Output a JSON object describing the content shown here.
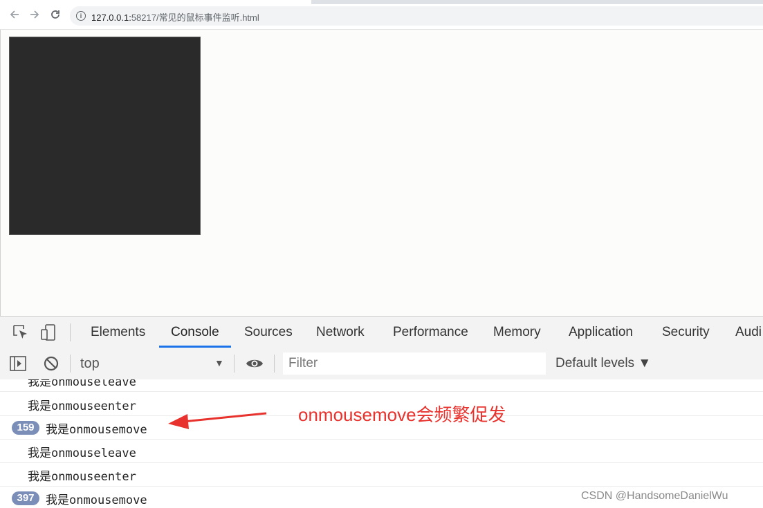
{
  "browser": {
    "url_host": "127.0.0.1:",
    "url_path": "58217/常见的鼠标事件监听.html",
    "back_icon": "back-arrow-icon",
    "forward_icon": "forward-arrow-icon",
    "reload_icon": "reload-icon",
    "site_info_icon": "info-icon"
  },
  "page": {
    "box_color": "#2a2a2a"
  },
  "devtools": {
    "tabs": [
      "Elements",
      "Console",
      "Sources",
      "Network",
      "Performance",
      "Memory",
      "Application",
      "Security",
      "Audi"
    ],
    "active_tab": "Console",
    "context": "top",
    "filter_placeholder": "Filter",
    "levels": "Default levels ▼",
    "accent_color": "#1a73e8"
  },
  "console": {
    "rows": [
      {
        "prefix": "我是",
        "event": "onmouseleave",
        "count": ""
      },
      {
        "prefix": "我是",
        "event": "onmouseenter",
        "count": ""
      },
      {
        "prefix": "我是",
        "event": "onmousemove",
        "count": "159"
      },
      {
        "prefix": "我是",
        "event": "onmouseleave",
        "count": ""
      },
      {
        "prefix": "我是",
        "event": "onmouseenter",
        "count": ""
      },
      {
        "prefix": "我是",
        "event": "onmousemove",
        "count": "397"
      }
    ]
  },
  "annotation": {
    "text": "onmousemove会频繁促发",
    "color": "#e8322d"
  },
  "watermark": "CSDN @HandsomeDanielWu"
}
